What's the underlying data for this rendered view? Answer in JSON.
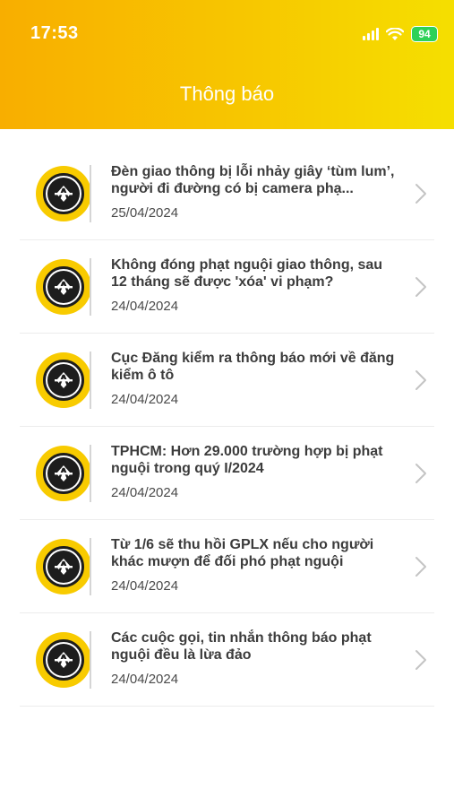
{
  "status_bar": {
    "time": "17:53",
    "battery": "94"
  },
  "header": {
    "title": "Thông báo"
  },
  "notifications": [
    {
      "title": "Đèn giao thông bị lỗi nhảy giây ‘tùm lum’, người đi đường có bị camera phạ...",
      "date": "25/04/2024"
    },
    {
      "title": "Không đóng phạt nguội giao thông, sau 12 tháng sẽ được 'xóa' vi phạm?",
      "date": "24/04/2024"
    },
    {
      "title": "Cục Đăng kiểm ra thông báo mới về đăng kiểm ô tô",
      "date": "24/04/2024"
    },
    {
      "title": "TPHCM: Hơn 29.000 trường hợp bị phạt nguội trong quý I/2024",
      "date": "24/04/2024"
    },
    {
      "title": "Từ 1/6 sẽ thu hồi GPLX nếu cho người khác mượn để đối phó phạt nguội",
      "date": "24/04/2024"
    },
    {
      "title": "Các cuộc gọi, tin nhắn thông báo phạt nguội đều là lừa đảo",
      "date": "24/04/2024"
    }
  ],
  "colors": {
    "header_start": "#f8ae00",
    "header_end": "#f5df00",
    "logo_yellow": "#f8cb00"
  }
}
